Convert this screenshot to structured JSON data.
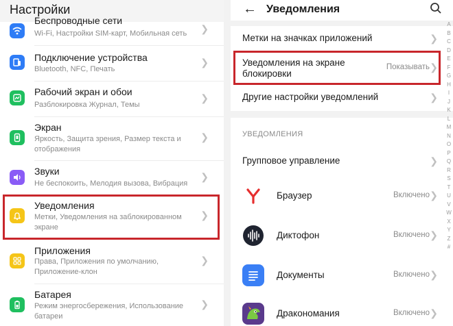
{
  "left": {
    "title": "Настройки",
    "items": [
      {
        "title": "Беспроводные сети",
        "subtitle": "Wi-Fi, Настройки SIM-карт, Мобильная сеть",
        "icon": "wifi-icon",
        "color": "#2e7cf6"
      },
      {
        "title": "Подключение устройства",
        "subtitle": "Bluetooth, NFC, Печать",
        "icon": "device-connect-icon",
        "color": "#2e7cf6"
      },
      {
        "title": "Рабочий экран и обои",
        "subtitle": "Разблокировка Журнал, Темы",
        "icon": "home-screen-icon",
        "color": "#1fbf5f"
      },
      {
        "title": "Экран",
        "subtitle": "Яркость, Защита зрения, Размер текста и отображения",
        "icon": "display-icon",
        "color": "#1fbf5f"
      },
      {
        "title": "Звуки",
        "subtitle": "Не беспокоить, Мелодия вызова, Вибрация",
        "icon": "sound-icon",
        "color": "#8a5cf6"
      },
      {
        "title": "Уведомления",
        "subtitle": "Метки, Уведомления на заблокированном экране",
        "icon": "bell-icon",
        "color": "#f5c518"
      },
      {
        "title": "Приложения",
        "subtitle": "Права, Приложения по умолчанию, Приложение-клон",
        "icon": "apps-icon",
        "color": "#f5c518"
      },
      {
        "title": "Батарея",
        "subtitle": "Режим энергосбережения, Использование батареи",
        "icon": "battery-icon",
        "color": "#1fbf5f"
      }
    ]
  },
  "right": {
    "title": "Уведомления",
    "settings": [
      {
        "title": "Метки на значках приложений",
        "value": ""
      },
      {
        "title": "Уведомления на экране блокировки",
        "value": "Показывать"
      },
      {
        "title": "Другие настройки уведомлений",
        "value": ""
      }
    ],
    "section_header": "УВЕДОМЛЕНИЯ",
    "group_label": "Групповое управление",
    "apps": [
      {
        "name": "Браузер",
        "status": "Включено",
        "icon": "yandex-browser-icon"
      },
      {
        "name": "Диктофон",
        "status": "Включено",
        "icon": "recorder-icon"
      },
      {
        "name": "Документы",
        "status": "Включено",
        "icon": "documents-icon"
      },
      {
        "name": "Дракономания",
        "status": "Включено",
        "icon": "dragon-game-icon"
      }
    ],
    "index_letters": [
      "A",
      "B",
      "C",
      "D",
      "E",
      "F",
      "G",
      "H",
      "I",
      "J",
      "K",
      "L",
      "M",
      "N",
      "O",
      "P",
      "Q",
      "R",
      "S",
      "T",
      "U",
      "V",
      "W",
      "X",
      "Y",
      "Z",
      "#"
    ]
  },
  "colors": {
    "highlight": "#c8262b",
    "chevron": "#c0c0c0"
  }
}
